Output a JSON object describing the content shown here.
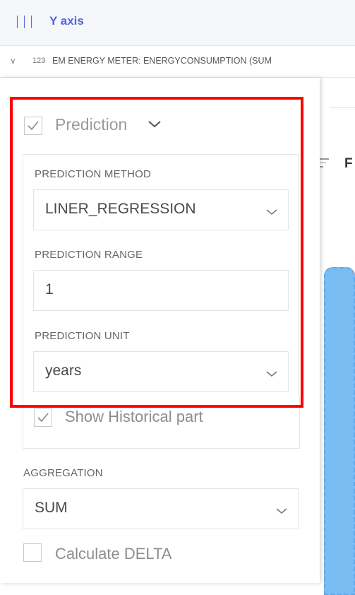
{
  "header": {
    "icon": "bars-icon",
    "title": "Y axis"
  },
  "field": {
    "type_badge": "123",
    "name": "EM ENERGY METER: ENERGYCONSUMPTION (SUM"
  },
  "background": {
    "partial_letter": "F",
    "bar_color": "#79bdf2"
  },
  "prediction": {
    "checked": true,
    "label": "Prediction",
    "method_label": "PREDICTION METHOD",
    "method_value": "LINER_REGRESSION",
    "range_label": "PREDICTION RANGE",
    "range_value": "1",
    "unit_label": "PREDICTION UNIT",
    "unit_value": "years"
  },
  "historical": {
    "checked": true,
    "label": "Show Historical part"
  },
  "aggregation": {
    "label": "AGGREGATION",
    "value": "SUM"
  },
  "delta": {
    "checked": false,
    "label": "Calculate DELTA"
  },
  "colors": {
    "accent": "#5566d9",
    "highlight": "#ff0000"
  }
}
